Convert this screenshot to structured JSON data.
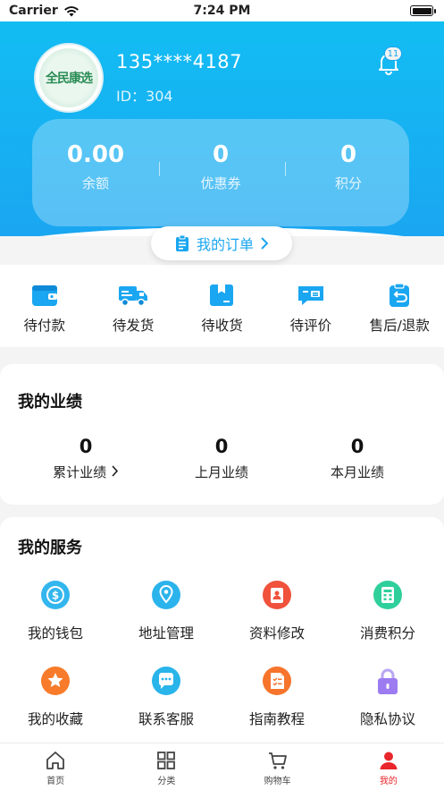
{
  "status_bar": {
    "carrier": "Carrier",
    "time": "7:24 PM"
  },
  "profile": {
    "avatar_text": "全民康选",
    "phone": "135****4187",
    "id_text": "ID：304",
    "notification_count": "11"
  },
  "assets": [
    {
      "value": "0.00",
      "label": "余额"
    },
    {
      "value": "0",
      "label": "优惠券"
    },
    {
      "value": "0",
      "label": "积分"
    }
  ],
  "orders": {
    "title": "我的订单",
    "items": [
      {
        "label": "待付款",
        "icon": "wallet-icon"
      },
      {
        "label": "待发货",
        "icon": "truck-icon"
      },
      {
        "label": "待收货",
        "icon": "package-icon"
      },
      {
        "label": "待评价",
        "icon": "review-icon"
      },
      {
        "label": "售后/退款",
        "icon": "refund-icon"
      }
    ]
  },
  "performance": {
    "title": "我的业绩",
    "items": [
      {
        "value": "0",
        "label": "累计业绩"
      },
      {
        "value": "0",
        "label": "上月业绩"
      },
      {
        "value": "0",
        "label": "本月业绩"
      }
    ]
  },
  "services": {
    "title": "我的服务",
    "items": [
      {
        "label": "我的钱包",
        "icon": "coin-icon",
        "color": "#33b6ee"
      },
      {
        "label": "地址管理",
        "icon": "location-icon",
        "color": "#2bb3ec"
      },
      {
        "label": "资料修改",
        "icon": "profile-edit-icon",
        "color": "#f0523c"
      },
      {
        "label": "消费积分",
        "icon": "points-icon",
        "color": "#2fcf9b"
      },
      {
        "label": "我的收藏",
        "icon": "star-icon",
        "color": "#f77b2a"
      },
      {
        "label": "联系客服",
        "icon": "chat-icon",
        "color": "#29b4ea"
      },
      {
        "label": "指南教程",
        "icon": "guide-icon",
        "color": "#f6742c"
      },
      {
        "label": "隐私协议",
        "icon": "lock-icon",
        "color": "#9c7cf0"
      }
    ]
  },
  "tabbar": {
    "items": [
      {
        "label": "首页",
        "icon": "home-icon"
      },
      {
        "label": "分类",
        "icon": "grid-icon"
      },
      {
        "label": "购物车",
        "icon": "cart-icon"
      },
      {
        "label": "我的",
        "icon": "user-icon"
      }
    ],
    "active": "我的",
    "active_color": "#e8262b"
  },
  "theme": {
    "primary": "#1aa6f1",
    "header_top": "#12bdf3"
  }
}
